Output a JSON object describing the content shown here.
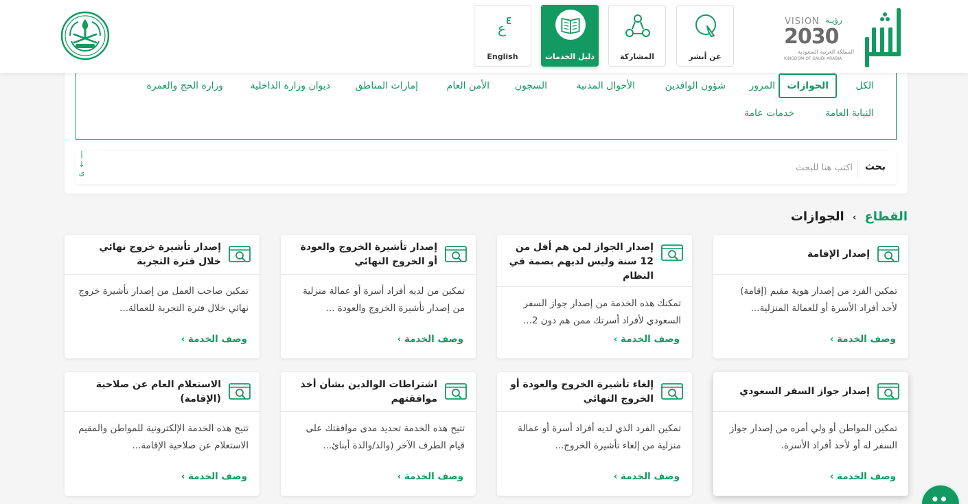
{
  "header": {
    "brand": {
      "vision_word": "VISION",
      "vision_ar": "رؤيـة",
      "vision_year": "2030",
      "kingdom_ar": "المملكة العربية السعودية",
      "kingdom_en": "KINGDOM OF SAUDI ARABIA"
    },
    "nav": [
      {
        "label": "عن أبشر",
        "icon": "cursor-click-icon"
      },
      {
        "label": "المشاركة",
        "icon": "share-network-icon"
      },
      {
        "label": "دليل الخدمات",
        "icon": "book-icon",
        "active": true
      },
      {
        "label": "English",
        "icon": "language-icon"
      }
    ],
    "language_glyph": "ع"
  },
  "filters": {
    "categories": [
      "الكل",
      "الجوازات",
      "المرور",
      "شؤون الوافدين",
      "الأحوال المدنية",
      "السجون",
      "الأمن العام",
      "إمارات المناطق",
      "ديوان وزارة الداخلية",
      "وزارة الحج والعمرة",
      "النيابة العامة",
      "خدمات عامة"
    ],
    "selected": "الجوازات",
    "search_label": "بحث",
    "search_placeholder": "اكتب هنا للبحث",
    "sort_glyphs": [
      "أ",
      "↓",
      "ى"
    ]
  },
  "breadcrumb": {
    "root": "القطاع",
    "separator": "›",
    "current": "الجوازات"
  },
  "service_link_label": "وصف الخدمة ›",
  "services": [
    {
      "title": "إصدار الإقامة",
      "desc": "تمكين الفرد من إصدار هوية مقيم (إقامة) لأحد أفراد الأسرة أو للعمالة المنزلية..."
    },
    {
      "title": "إصدار الجواز لمن هم أقل من 12 سنة وليس لديهم بصمة في النظام",
      "desc": "تمكنك هذه الخدمة من إصدار جواز السفر السعودي لأفراد أسرتك ممن هم دون 2..."
    },
    {
      "title": "إصدار تأشيرة الخروج والعودة أو الخروج النهائي",
      "desc": "تمكين من لديه أفراد أسرة أو عمالة منزلية من إصدار تأشيرة الخروج والعودة ..."
    },
    {
      "title": "إصدار تأشيرة خروج نهائي خلال فترة التجربة",
      "desc": "تمكين صاحب العمل من إصدار تأشيرة خروج نهائي خلال فترة التجربة للعمالة..."
    },
    {
      "title": "إصدار جواز السفر السعودي",
      "desc": "تمكين المواطن أو ولي أمره من إصدار جواز السفر له أو لأحد أفراد الأسرة."
    },
    {
      "title": "إلغاء تأشيرة الخروج والعودة أو الخروج النهائي",
      "desc": "تمكين الفرد الذي لديه أفراد أسرة أو عمالة منزلية من إلغاء تأشيرة الخروج..."
    },
    {
      "title": "اشتراطات الوالدين بشأن أخذ موافقتهم",
      "desc": "تتيح هذه الخدمة تحديد مدى موافقتك على قيام الطرف الآخر (والد/والدة أبنائ..."
    },
    {
      "title": "الاستعلام العام عن صلاحية (الإقامة)",
      "desc": "تتيح هذه الخدمة الإلكترونية للمواطن والمقيم الاستعلام عن صلاحية الإقامة..."
    }
  ],
  "colors": {
    "accent": "#129a62",
    "background": "#f5f5f5"
  }
}
